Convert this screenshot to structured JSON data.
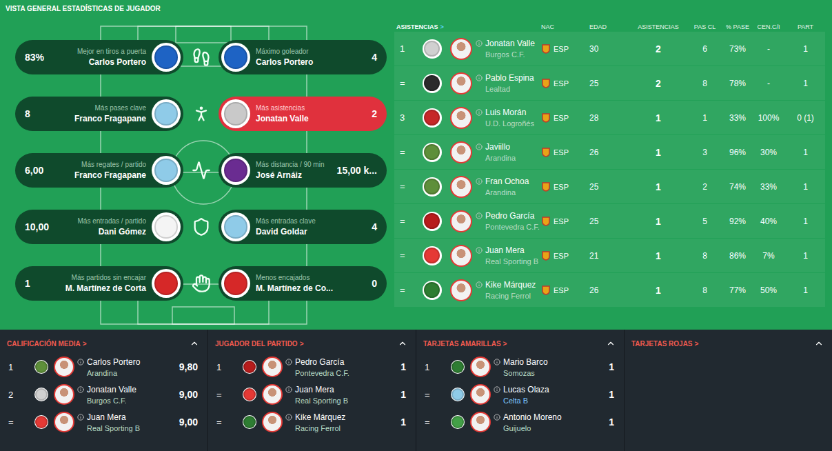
{
  "title": "VISTA GENERAL ESTADÍSTICAS DE JUGADOR",
  "highlights": [
    {
      "left": {
        "label": "Mejor en tiros a puerta",
        "name": "Carlos Portero",
        "value": "83%",
        "color": "#1e63c4",
        "highlighted": false
      },
      "right": {
        "label": "Máximo goleador",
        "name": "Carlos Portero",
        "value": "4",
        "color": "#1e63c4",
        "highlighted": false
      }
    },
    {
      "left": {
        "label": "Más pases clave",
        "name": "Franco Fragapane",
        "value": "8",
        "color": "#8fcbe8",
        "highlighted": false
      },
      "right": {
        "label": "Más asistencias",
        "name": "Jonatan Valle",
        "value": "2",
        "color": "#c9c9c9",
        "highlighted": true
      }
    },
    {
      "left": {
        "label": "Más regates / partido",
        "name": "Franco Fragapane",
        "value": "6,00",
        "color": "#8fcbe8",
        "highlighted": false
      },
      "right": {
        "label": "Más distancia / 90 min",
        "name": "José Arnáiz",
        "value": "15,00 k...",
        "color": "#6a2c91",
        "highlighted": false
      }
    },
    {
      "left": {
        "label": "Más entradas / partido",
        "name": "Dani Gómez",
        "value": "10,00",
        "color": "#f4f4f4",
        "highlighted": false
      },
      "right": {
        "label": "Más entradas clave",
        "name": "David Goldar",
        "value": "4",
        "color": "#8fcbe8",
        "highlighted": false
      }
    },
    {
      "left": {
        "label": "Más partidos sin encajar",
        "name": "M. Martínez de Corta",
        "value": "1",
        "color": "#d62828",
        "highlighted": false
      },
      "right": {
        "label": "Menos encajados",
        "name": "M. Martínez de Co...",
        "value": "0",
        "color": "#d62828",
        "highlighted": false
      }
    }
  ],
  "assists": {
    "title": "ASISTENCIAS",
    "arrow": ">",
    "columns": [
      "NAC",
      "EDAD",
      "ASISTENCIAS",
      "PAS CL",
      "% PASE",
      "CEN.C/I",
      "PART"
    ],
    "rows": [
      {
        "rank": "1",
        "name": "Jonatan Valle",
        "club": "Burgos C.F.",
        "color": "#d0d0d0",
        "nationality": "ESP",
        "age": "30",
        "assists": "2",
        "key_passes": "6",
        "pass_pct": "73%",
        "crosses": "-",
        "apps": "1"
      },
      {
        "rank": "=",
        "name": "Pablo Espina",
        "club": "Lealtad",
        "color": "#2b2b2b",
        "nationality": "ESP",
        "age": "25",
        "assists": "2",
        "key_passes": "8",
        "pass_pct": "78%",
        "crosses": "-",
        "apps": "1"
      },
      {
        "rank": "3",
        "name": "Luis Morán",
        "club": "U.D. Logroñés",
        "color": "#c62828",
        "nationality": "ESP",
        "age": "28",
        "assists": "1",
        "key_passes": "1",
        "pass_pct": "33%",
        "crosses": "100%",
        "apps": "0 (1)"
      },
      {
        "rank": "=",
        "name": "Javiillo",
        "club": "Arandina",
        "color": "#5e8f3a",
        "nationality": "ESP",
        "age": "26",
        "assists": "1",
        "key_passes": "3",
        "pass_pct": "96%",
        "crosses": "30%",
        "apps": "1"
      },
      {
        "rank": "=",
        "name": "Fran Ochoa",
        "club": "Arandina",
        "color": "#5e8f3a",
        "nationality": "ESP",
        "age": "25",
        "assists": "1",
        "key_passes": "2",
        "pass_pct": "74%",
        "crosses": "33%",
        "apps": "1"
      },
      {
        "rank": "=",
        "name": "Pedro García",
        "club": "Pontevedra C.F.",
        "color": "#b71c1c",
        "nationality": "ESP",
        "age": "25",
        "assists": "1",
        "key_passes": "5",
        "pass_pct": "92%",
        "crosses": "40%",
        "apps": "1"
      },
      {
        "rank": "=",
        "name": "Juan Mera",
        "club": "Real Sporting B",
        "color": "#e53935",
        "nationality": "ESP",
        "age": "21",
        "assists": "1",
        "key_passes": "8",
        "pass_pct": "86%",
        "crosses": "7%",
        "apps": "1"
      },
      {
        "rank": "=",
        "name": "Kike Márquez",
        "club": "Racing Ferrol",
        "color": "#2e7d32",
        "nationality": "ESP",
        "age": "26",
        "assists": "1",
        "key_passes": "8",
        "pass_pct": "77%",
        "crosses": "50%",
        "apps": "1"
      }
    ]
  },
  "panels": [
    {
      "title": "CALIFICACIÓN MEDIA",
      "arrow": ">",
      "rows": [
        {
          "rank": "1",
          "name": "Carlos Portero",
          "club": "Arandina",
          "color": "#5e8f3a",
          "value": "9,80",
          "highlighted": false
        },
        {
          "rank": "2",
          "name": "Jonatan Valle",
          "club": "Burgos C.F.",
          "color": "#d0d0d0",
          "value": "9,00",
          "highlighted": false
        },
        {
          "rank": "=",
          "name": "Juan Mera",
          "club": "Real Sporting B",
          "color": "#e53935",
          "value": "9,00",
          "highlighted": false
        }
      ]
    },
    {
      "title": "JUGADOR DEL PARTIDO",
      "arrow": ">",
      "rows": [
        {
          "rank": "1",
          "name": "Pedro García",
          "club": "Pontevedra C.F.",
          "color": "#b71c1c",
          "value": "1",
          "highlighted": false
        },
        {
          "rank": "=",
          "name": "Juan Mera",
          "club": "Real Sporting B",
          "color": "#e53935",
          "value": "1",
          "highlighted": false
        },
        {
          "rank": "=",
          "name": "Kike Márquez",
          "club": "Racing Ferrol",
          "color": "#2e7d32",
          "value": "1",
          "highlighted": false
        }
      ]
    },
    {
      "title": "TARJETAS AMARILLAS",
      "arrow": ">",
      "rows": [
        {
          "rank": "1",
          "name": "Mario Barco",
          "club": "Somozas",
          "color": "#2e7d32",
          "value": "1",
          "highlighted": false
        },
        {
          "rank": "=",
          "name": "Lucas Olaza",
          "club": "Celta B",
          "color": "#8fcbe8",
          "value": "1",
          "highlighted": true
        },
        {
          "rank": "=",
          "name": "Antonio Moreno",
          "club": "Guijuelo",
          "color": "#43a047",
          "value": "1",
          "highlighted": false
        }
      ]
    },
    {
      "title": "TARJETAS ROJAS",
      "arrow": ">",
      "rows": []
    }
  ]
}
